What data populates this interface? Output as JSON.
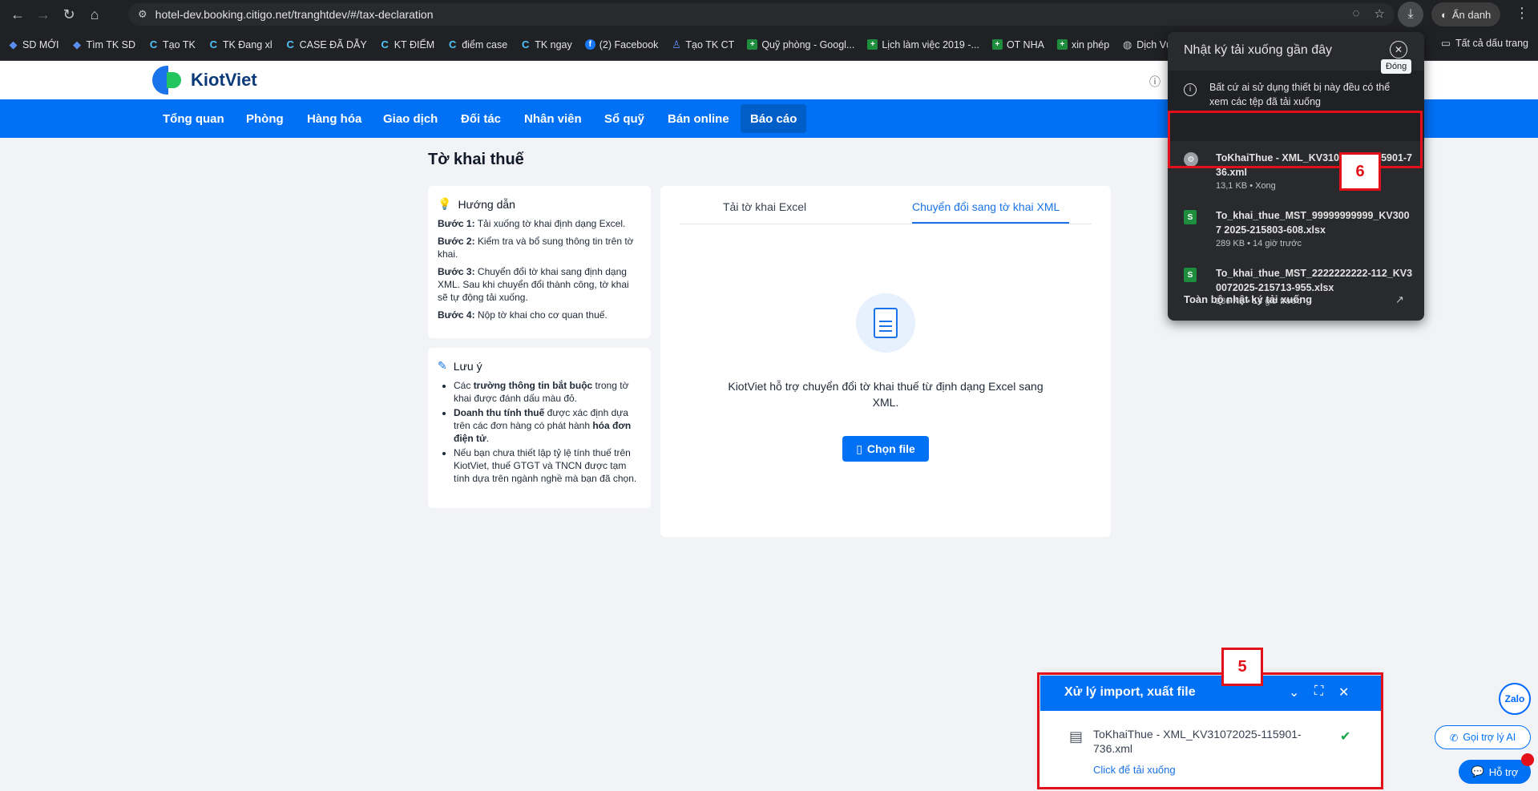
{
  "browser": {
    "url": "hotel-dev.booking.citigo.net/tranghtdev/#/tax-declaration",
    "incognito_label": "Ẩn danh",
    "bookmarks": [
      {
        "label": "SD MỚI",
        "icon": "jira-icon"
      },
      {
        "label": "Tìm TK SD",
        "icon": "jira-icon"
      },
      {
        "label": "Tạo TK",
        "icon": "citigo-icon"
      },
      {
        "label": "TK Đang xl",
        "icon": "citigo-icon"
      },
      {
        "label": "CASE ĐÃ DẪY",
        "icon": "citigo-icon"
      },
      {
        "label": "KT ĐIỂM",
        "icon": "citigo-icon"
      },
      {
        "label": "điểm case",
        "icon": "citigo-icon"
      },
      {
        "label": "TK ngay",
        "icon": "citigo-icon"
      },
      {
        "label": "(2) Facebook",
        "icon": "facebook-icon"
      },
      {
        "label": "Tạo TK CT",
        "icon": "figure-icon"
      },
      {
        "label": "Quỹ phòng - Googl...",
        "icon": "sheets-icon"
      },
      {
        "label": "Lịch làm việc 2019 -...",
        "icon": "sheets-icon"
      },
      {
        "label": "OT NHA",
        "icon": "sheets-icon"
      },
      {
        "label": "xin phép",
        "icon": "sheets-icon"
      },
      {
        "label": "Dịch Vụ",
        "icon": "globe-icon"
      }
    ],
    "all_bookmarks": "Tất cả dấu trang"
  },
  "app": {
    "logo_text": "KiotViet",
    "nav": [
      "Tổng quan",
      "Phòng",
      "Hàng hóa",
      "Giao dịch",
      "Đối tác",
      "Nhân viên",
      "Sổ quỹ",
      "Bán online",
      "Báo cáo"
    ],
    "active_nav": "Báo cáo"
  },
  "page": {
    "title": "Tờ khai thuế",
    "guide": {
      "title": "Hướng dẫn",
      "steps": [
        {
          "label": "Bước 1:",
          "text": " Tải xuống tờ khai định dạng Excel."
        },
        {
          "label": "Bước 2:",
          "text": " Kiểm tra và bổ sung thông tin trên tờ khai."
        },
        {
          "label": "Bước 3:",
          "text": " Chuyển đổi tờ khai sang định dạng XML. Sau khi chuyển đổi thành công, tờ khai sẽ tự động tải xuống."
        },
        {
          "label": "Bước 4:",
          "text": " Nộp tờ khai cho cơ quan thuế."
        }
      ]
    },
    "note": {
      "title": "Lưu ý",
      "items": [
        {
          "a": "Các ",
          "b": "trường thông tin bắt buộc",
          "c": " trong tờ khai được đánh dấu màu đỏ.",
          "d": "",
          "e": ""
        },
        {
          "a": "",
          "b": "Doanh thu tính thuế",
          "c": " được xác định dựa trên các đơn hàng có phát hành ",
          "d": "hóa đơn điện tử",
          "e": "."
        },
        {
          "a": "Nếu bạn chưa thiết lập tỷ lệ tính thuế trên KiotViet, thuế GTGT và TNCN được tạm tính dựa trên ngành nghề mà bạn đã chọn.",
          "b": "",
          "c": "",
          "d": "",
          "e": ""
        }
      ]
    },
    "tabs": [
      "Tải tờ khai Excel",
      "Chuyển đổi sang tờ khai XML"
    ],
    "active_tab": "Chuyển đổi sang tờ khai XML",
    "description": "KiotViet hỗ trợ chuyển đổi tờ khai thuế từ định dạng Excel sang XML.",
    "choose_file": "Chọn file"
  },
  "downloads": {
    "title": "Nhật ký tải xuống gần đây",
    "close_tooltip": "Đóng",
    "info": "Bất cứ ai sử dụng thiết bị này đều có thể xem các tệp đã tải xuống",
    "items": [
      {
        "name": "ToKhaiThue - XML_KV31072025-115901-736.xml",
        "meta": "13,1 KB • Xong",
        "type": "xml"
      },
      {
        "name": "To_khai_thue_MST_99999999999_KV3007 2025-215803-608.xlsx",
        "meta": "289 KB • 14 giờ trước",
        "type": "xlsx"
      },
      {
        "name": "To_khai_thue_MST_2222222222-112_KV3 0072025-215713-955.xlsx",
        "meta": "286 KB • 14 giờ trước",
        "type": "xlsx"
      }
    ],
    "footer": "Toàn bộ nhật ký tải xuống"
  },
  "import_panel": {
    "title": "Xử lý import, xuất file",
    "file_name": "ToKhaiThue - XML_KV31072025-115901-736.xml",
    "link": "Click để tải xuống"
  },
  "annotations": {
    "badge_5": "5",
    "badge_6": "6"
  },
  "support": {
    "zalo": "Zalo",
    "ai": "Gọi trợ lý AI",
    "help": "Hỗ trợ"
  }
}
